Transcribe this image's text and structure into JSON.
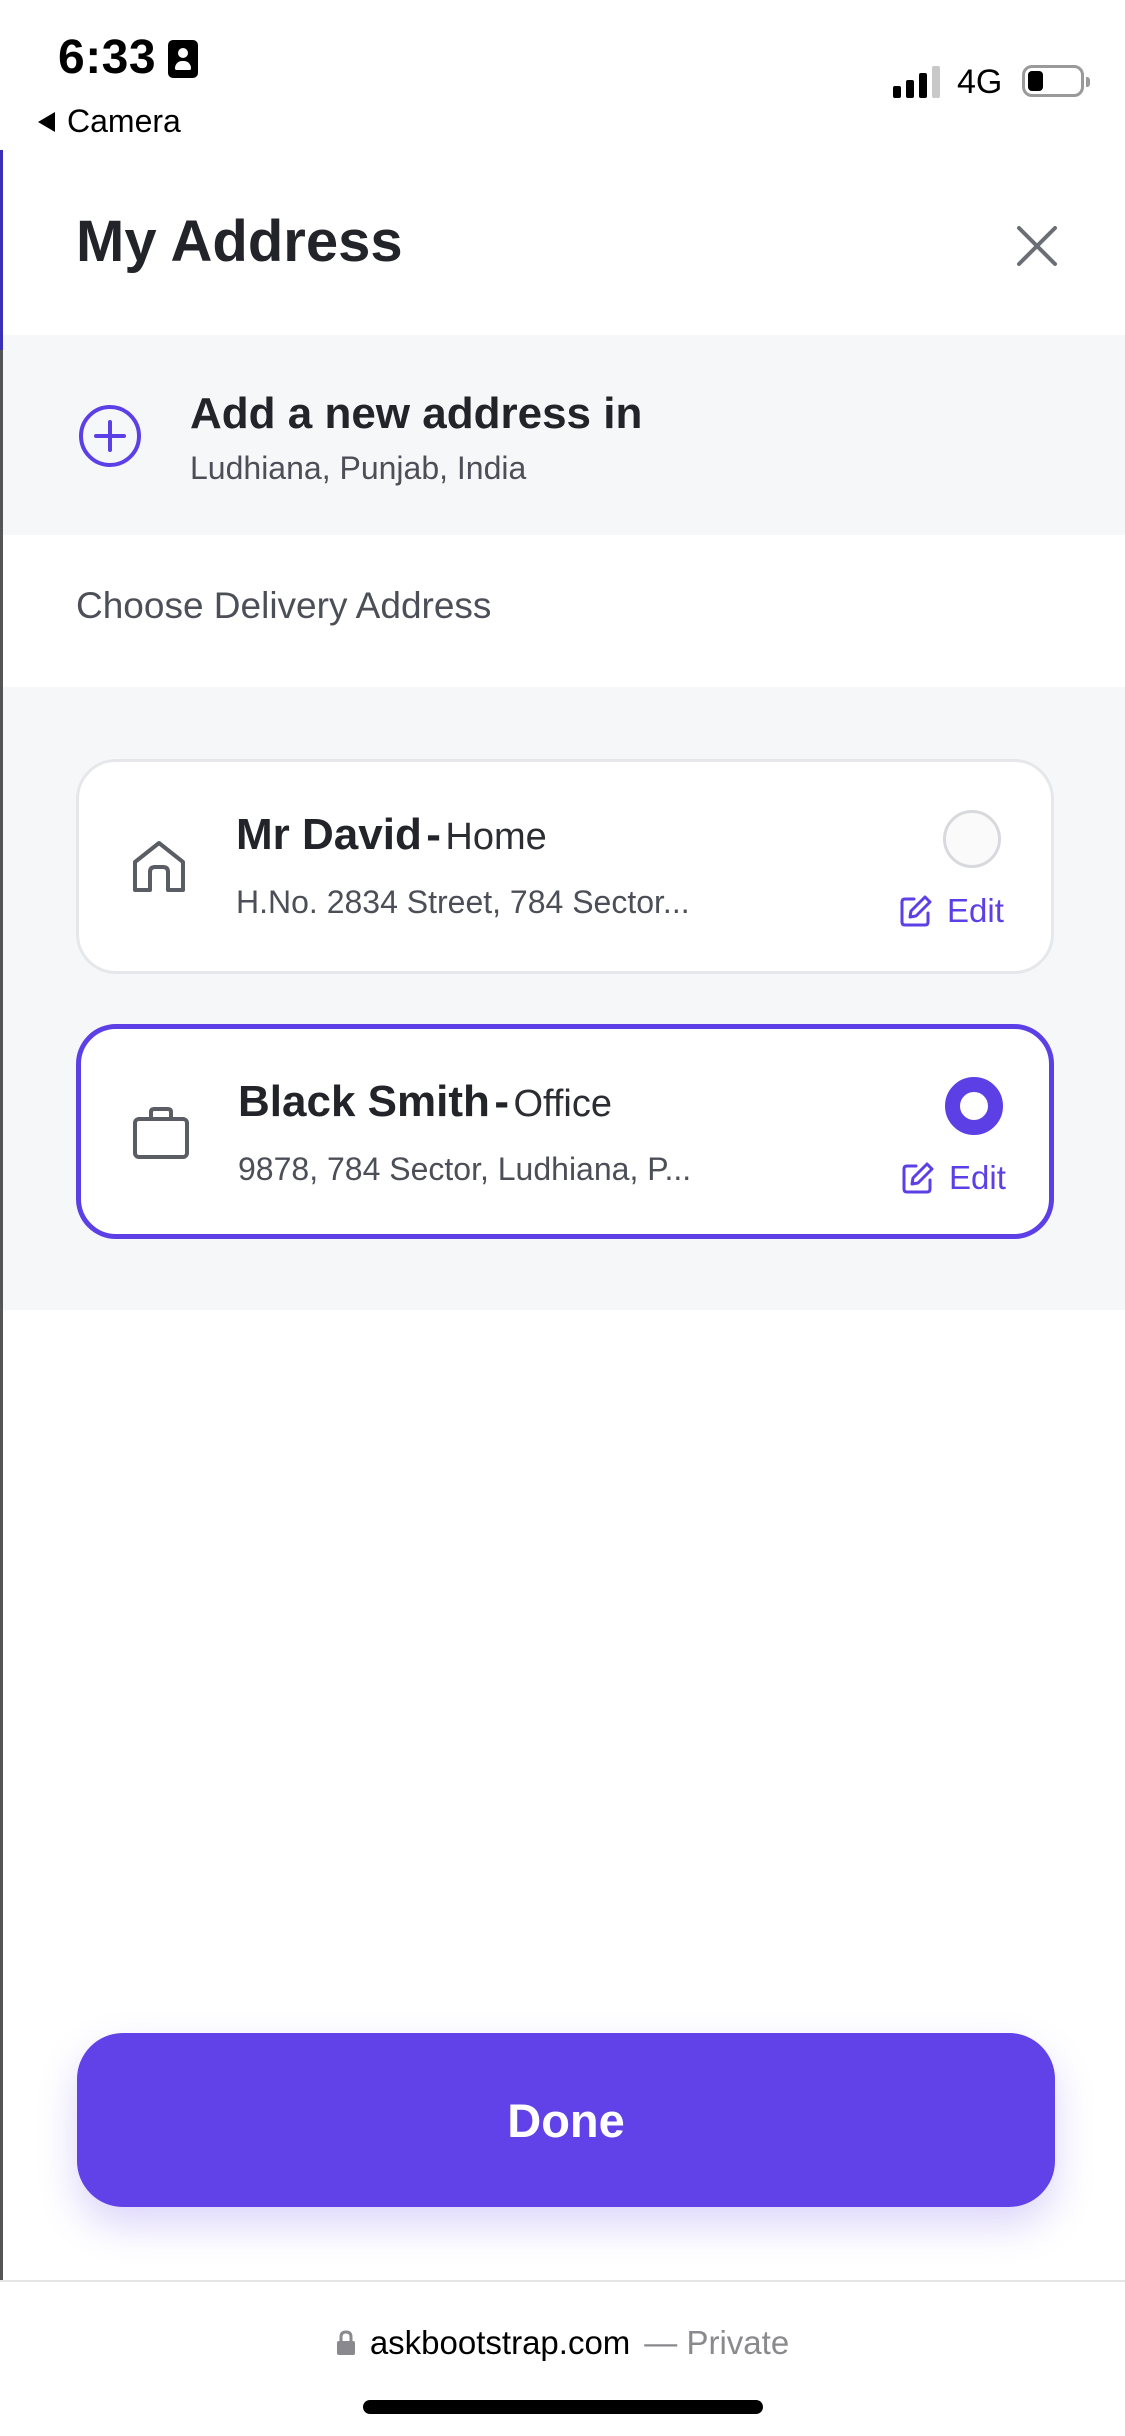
{
  "status_bar": {
    "time": "6:33",
    "back_app": "Camera",
    "network": "4G",
    "battery_level": 0.3
  },
  "header": {
    "title": "My Address"
  },
  "add_address": {
    "title": "Add a new address in",
    "location": "Ludhiana, Punjab, India"
  },
  "section": {
    "label": "Choose Delivery Address"
  },
  "addresses": [
    {
      "name": "Mr David",
      "separator": "-",
      "type": "Home",
      "line": "H.No. 2834 Street, 784 Sector...",
      "icon": "home-icon",
      "selected": false,
      "edit_label": "Edit"
    },
    {
      "name": "Black Smith",
      "separator": "-",
      "type": "Office",
      "line": "9878, 784 Sector, Ludhiana, P...",
      "icon": "briefcase-icon",
      "selected": true,
      "edit_label": "Edit"
    }
  ],
  "done_button": {
    "label": "Done"
  },
  "browser": {
    "domain": "askbootstrap.com",
    "suffix": "— Private"
  },
  "colors": {
    "accent": "#6142e8",
    "selected_border": "#5d3fe6",
    "panel_bg": "#f6f7f9",
    "text_primary": "#22242a"
  }
}
